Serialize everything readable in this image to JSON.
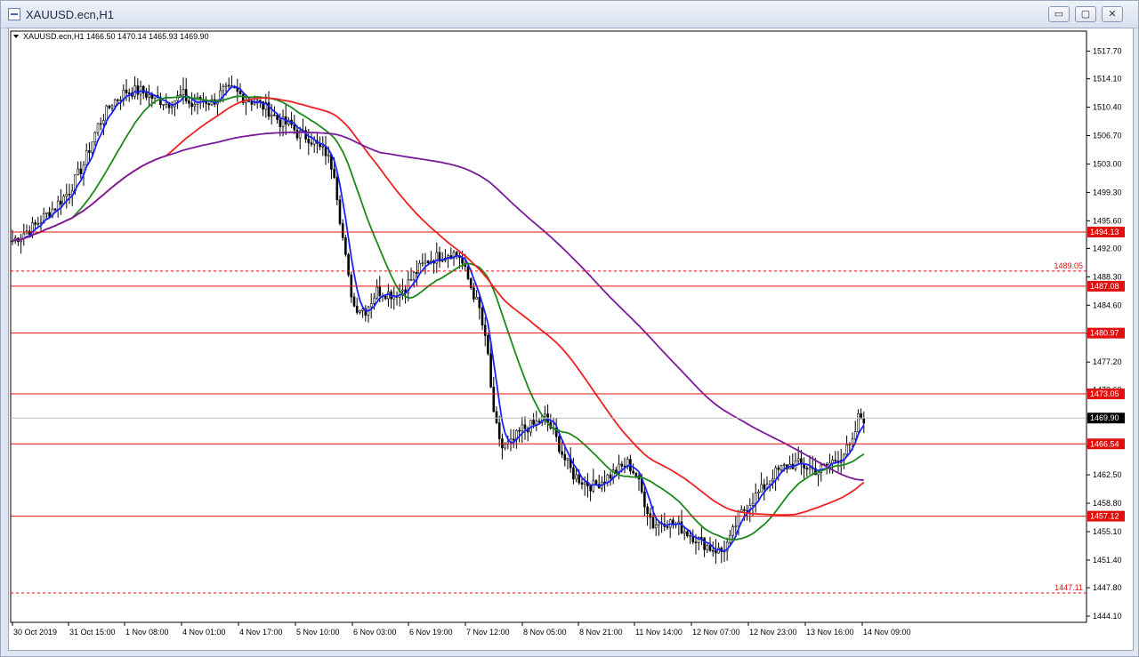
{
  "window": {
    "title": "XAUUSD.ecn,H1",
    "minimize_glyph": "▭",
    "restore_glyph": "▢",
    "close_glyph": "✕"
  },
  "chart_data": {
    "type": "candlestick",
    "symbol_label": "XAUUSD.ecn,H1",
    "ohlc_label": "1466.50 1470.14 1465.93 1469.90",
    "ylim": [
      1444.1,
      1519.5
    ],
    "y_ticks": [
      "1517.70",
      "1514.10",
      "1510.40",
      "1506.70",
      "1503.00",
      "1499.30",
      "1495.60",
      "1492.00",
      "1488.30",
      "1484.60",
      "1480.90",
      "1477.20",
      "1473.60",
      "1469.90",
      "1466.20",
      "1462.50",
      "1458.80",
      "1455.10",
      "1451.40",
      "1447.80",
      "1444.10"
    ],
    "x_ticks": [
      "30 Oct 2019",
      "31 Oct 15:00",
      "1 Nov 08:00",
      "4 Nov 01:00",
      "4 Nov 17:00",
      "5 Nov 10:00",
      "6 Nov 03:00",
      "6 Nov 19:00",
      "7 Nov 12:00",
      "8 Nov 05:00",
      "8 Nov 21:00",
      "11 Nov 14:00",
      "12 Nov 07:00",
      "12 Nov 23:00",
      "13 Nov 16:00",
      "14 Nov 09:00"
    ],
    "last_price": "1469.90",
    "horizontal_levels": [
      {
        "value": 1494.13,
        "label": "1494.13",
        "style": "solid",
        "color": "#e01010"
      },
      {
        "value": 1489.05,
        "label": "1489.05",
        "style": "dashed",
        "color": "#e01010"
      },
      {
        "value": 1487.08,
        "label": "1487.08",
        "style": "solid",
        "color": "#e01010"
      },
      {
        "value": 1480.97,
        "label": "1480.97",
        "style": "solid",
        "color": "#e01010"
      },
      {
        "value": 1473.05,
        "label": "1473.05",
        "style": "solid",
        "color": "#e01010"
      },
      {
        "value": 1466.54,
        "label": "1466.54",
        "style": "solid",
        "color": "#e01010"
      },
      {
        "value": 1457.12,
        "label": "1457.12",
        "style": "solid",
        "color": "#e01010"
      },
      {
        "value": 1447.11,
        "label": "1447.11",
        "style": "dashed",
        "color": "#e01010"
      }
    ],
    "close_path": [
      [
        0,
        1493
      ],
      [
        8,
        1495
      ],
      [
        15,
        1497.5
      ],
      [
        20,
        1499.5
      ],
      [
        25,
        1503
      ],
      [
        30,
        1508
      ],
      [
        35,
        1511
      ],
      [
        40,
        1512.5
      ],
      [
        45,
        1512.5
      ],
      [
        50,
        1511.5
      ],
      [
        55,
        1511
      ],
      [
        60,
        1512
      ],
      [
        63,
        1510.5
      ],
      [
        66,
        1511.5
      ],
      [
        70,
        1511
      ],
      [
        74,
        1512.5
      ],
      [
        78,
        1512.5
      ],
      [
        82,
        1511.5
      ],
      [
        86,
        1511
      ],
      [
        90,
        1510
      ],
      [
        94,
        1508.5
      ],
      [
        98,
        1508
      ],
      [
        100,
        1507
      ],
      [
        104,
        1506.5
      ],
      [
        108,
        1505
      ],
      [
        110,
        1504.5
      ],
      [
        113,
        1502
      ],
      [
        115,
        1496
      ],
      [
        118,
        1488
      ],
      [
        120,
        1484.5
      ],
      [
        124,
        1484
      ],
      [
        128,
        1486.5
      ],
      [
        134,
        1486
      ],
      [
        138,
        1487
      ],
      [
        142,
        1489
      ],
      [
        146,
        1490.5
      ],
      [
        150,
        1491
      ],
      [
        154,
        1491.5
      ],
      [
        157,
        1491
      ],
      [
        160,
        1488
      ],
      [
        164,
        1484
      ],
      [
        167,
        1478
      ],
      [
        169,
        1470
      ],
      [
        172,
        1466
      ],
      [
        175,
        1466.5
      ],
      [
        179,
        1468.5
      ],
      [
        183,
        1469
      ],
      [
        187,
        1470
      ],
      [
        190,
        1468
      ],
      [
        194,
        1464.5
      ],
      [
        197,
        1462.5
      ],
      [
        201,
        1461.5
      ],
      [
        204,
        1461
      ],
      [
        208,
        1462
      ],
      [
        212,
        1463
      ],
      [
        216,
        1464
      ],
      [
        219,
        1462.5
      ],
      [
        222,
        1459
      ],
      [
        225,
        1456
      ],
      [
        229,
        1456.5
      ],
      [
        233,
        1456
      ],
      [
        237,
        1455
      ],
      [
        241,
        1454
      ],
      [
        245,
        1453
      ],
      [
        249,
        1452.5
      ],
      [
        252,
        1454
      ],
      [
        255,
        1457
      ],
      [
        259,
        1459
      ],
      [
        263,
        1460.5
      ],
      [
        267,
        1462.5
      ],
      [
        271,
        1463.5
      ],
      [
        275,
        1464
      ],
      [
        279,
        1463.5
      ],
      [
        283,
        1463
      ],
      [
        287,
        1464
      ],
      [
        291,
        1465
      ],
      [
        295,
        1466.5
      ],
      [
        297,
        1469.9
      ]
    ],
    "moving_averages": [
      {
        "color": "#1a22ff",
        "period": 5
      },
      {
        "color": "#1b8a1b",
        "period": 22
      },
      {
        "color": "#f02020",
        "period": 55
      },
      {
        "color": "#7a1a9a",
        "period": 130
      }
    ]
  }
}
